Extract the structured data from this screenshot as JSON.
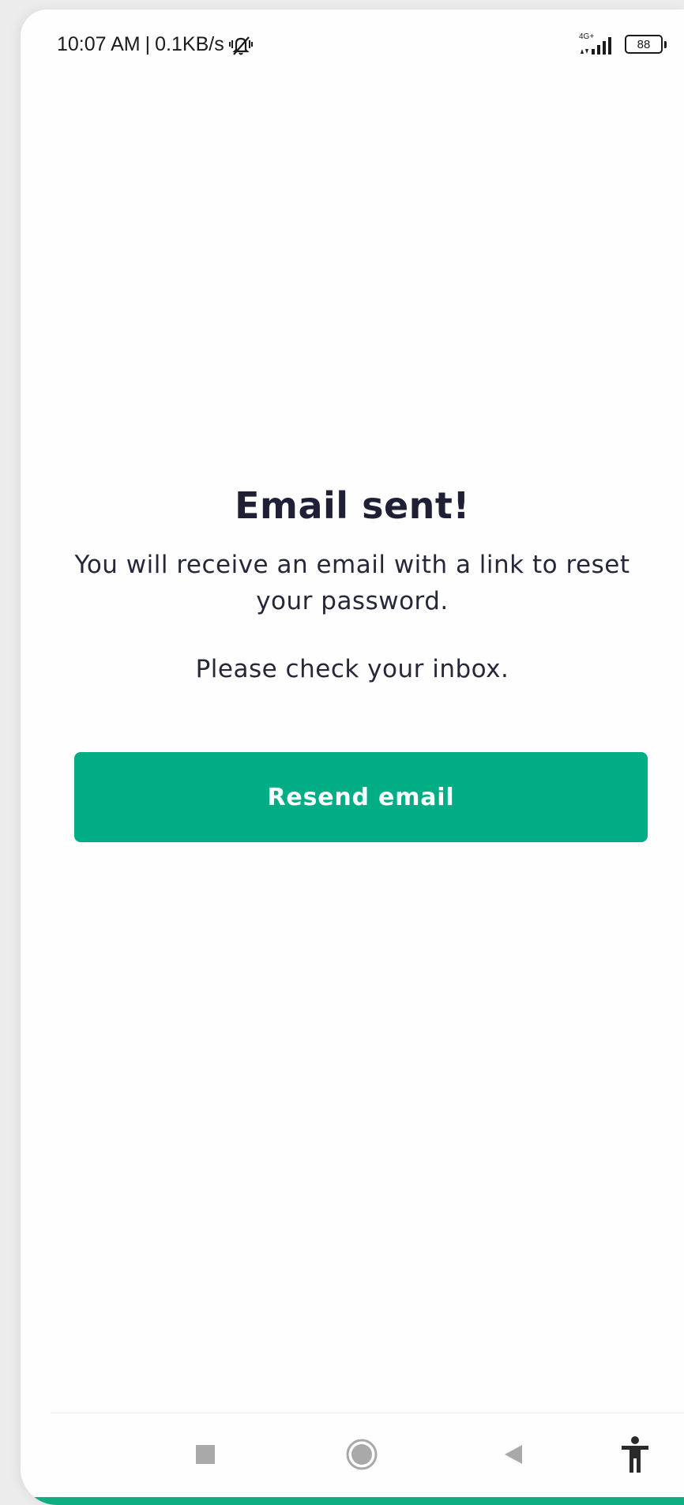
{
  "status_bar": {
    "time": "10:07 AM",
    "separator": "|",
    "network_speed": "0.1KB/s",
    "network_type": "4G+",
    "battery_level": "88",
    "icons": [
      "mute-icon",
      "signal-icon",
      "battery-icon"
    ]
  },
  "main": {
    "title": "Email sent!",
    "message": "You will receive an email with a link to reset your password.",
    "hint": "Please check your inbox.",
    "resend_label": "Resend email"
  },
  "nav_bar": {
    "icons": [
      "recents-icon",
      "home-icon",
      "back-icon",
      "accessibility-icon"
    ]
  },
  "colors": {
    "accent": "#00ad85",
    "text_dark": "#1f2036",
    "background": "#fefefe"
  }
}
